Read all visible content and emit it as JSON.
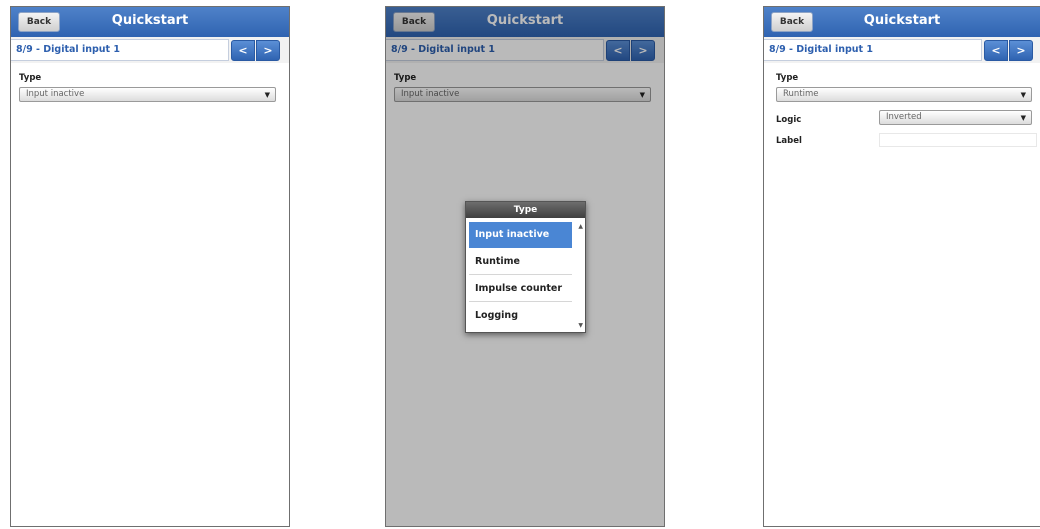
{
  "screens": [
    {
      "back_label": "Back",
      "title": "Quickstart",
      "step": "8/9 - Digital input 1",
      "prev_label": "<",
      "next_label": ">",
      "type_label": "Type",
      "type_value": "Input inactive"
    },
    {
      "back_label": "Back",
      "title": "Quickstart",
      "step": "8/9 - Digital input 1",
      "prev_label": "<",
      "next_label": ">",
      "type_label": "Type",
      "type_value": "Input inactive",
      "dialog": {
        "title": "Type",
        "options": [
          "Input inactive",
          "Runtime",
          "Impulse counter",
          "Logging"
        ],
        "selected": "Input inactive"
      }
    },
    {
      "back_label": "Back",
      "title": "Quickstart",
      "step": "8/9 - Digital input 1",
      "prev_label": "<",
      "next_label": ">",
      "type_label": "Type",
      "type_value": "Runtime",
      "logic_label": "Logic",
      "logic_value": "Inverted",
      "label_label": "Label",
      "label_value": ""
    }
  ],
  "icons": {
    "dropdown": "triangle-down-icon",
    "scroll_up": "scroll-up-icon",
    "scroll_down": "scroll-down-icon"
  },
  "colors": {
    "header": "#2f63b1",
    "step_text": "#2d5fae",
    "selected_option": "#4a86d4"
  }
}
